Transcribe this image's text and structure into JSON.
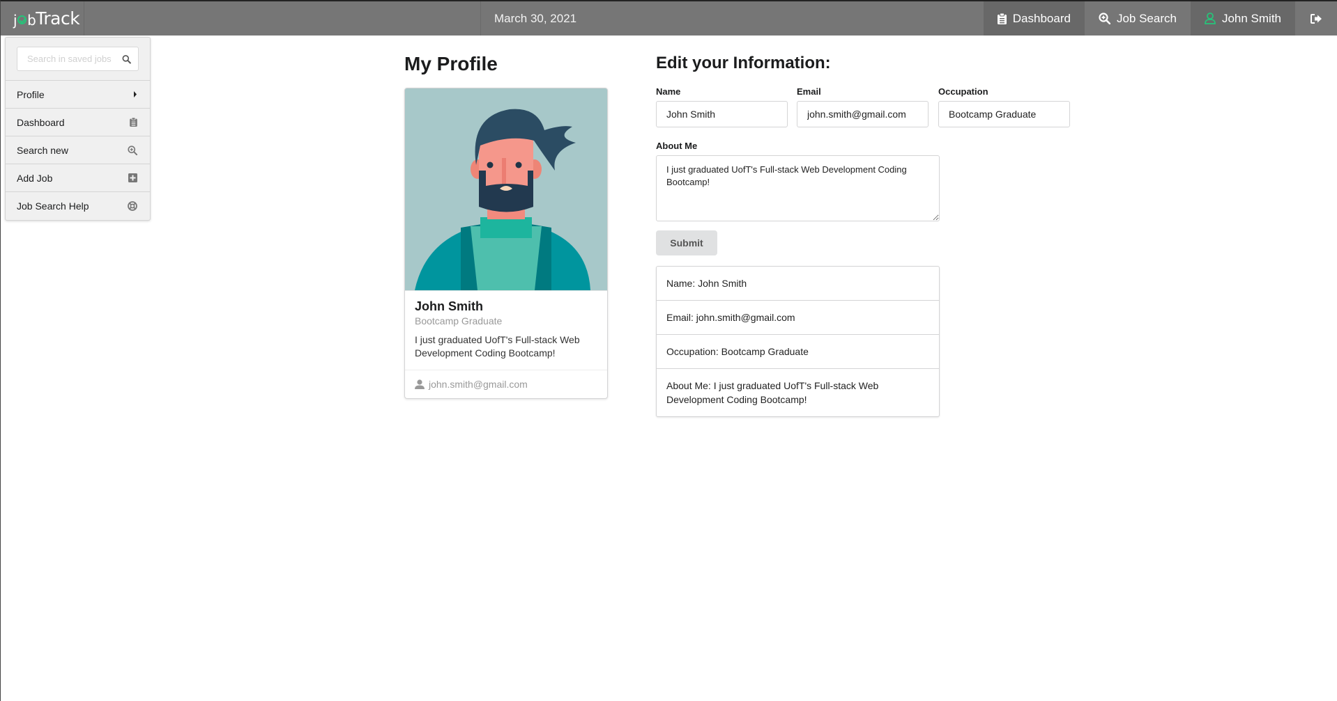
{
  "header": {
    "logo_prefix": "j",
    "logo_b": "b",
    "logo_main": "Track",
    "date": "March 30, 2021",
    "nav": [
      {
        "label": "Dashboard",
        "icon": "clipboard-icon"
      },
      {
        "label": "Job Search",
        "icon": "zoom-in-icon"
      },
      {
        "label": "John Smith",
        "icon": "user-icon"
      }
    ],
    "logout_icon": "sign-out-icon",
    "accent_color": "#27c37a"
  },
  "sidebar": {
    "search_placeholder": "Search in saved jobs",
    "items": [
      {
        "label": "Profile",
        "icon": "caret-right-icon"
      },
      {
        "label": "Dashboard",
        "icon": "clipboard-icon"
      },
      {
        "label": "Search new",
        "icon": "zoom-in-icon"
      },
      {
        "label": "Add Job",
        "icon": "plus-square-icon"
      },
      {
        "label": "Job Search Help",
        "icon": "life-ring-icon"
      }
    ]
  },
  "profile": {
    "title": "My Profile",
    "name": "John Smith",
    "occupation": "Bootcamp Graduate",
    "about": "I just graduated UofT's Full-stack Web Development Coding Bootcamp!",
    "email": "john.smith@gmail.com"
  },
  "edit_form": {
    "title": "Edit your Information:",
    "name_label": "Name",
    "name_value": "John Smith",
    "email_label": "Email",
    "email_value": "john.smith@gmail.com",
    "occupation_label": "Occupation",
    "occupation_value": "Bootcamp Graduate",
    "about_label": "About Me",
    "about_value": "I just graduated UofT's Full-stack Web Development Coding Bootcamp!",
    "submit_label": "Submit"
  },
  "info_list": [
    "Name: John Smith",
    "Email: john.smith@gmail.com",
    "Occupation: Bootcamp Graduate",
    "About Me: I just graduated UofT's Full-stack Web Development Coding Bootcamp!"
  ]
}
